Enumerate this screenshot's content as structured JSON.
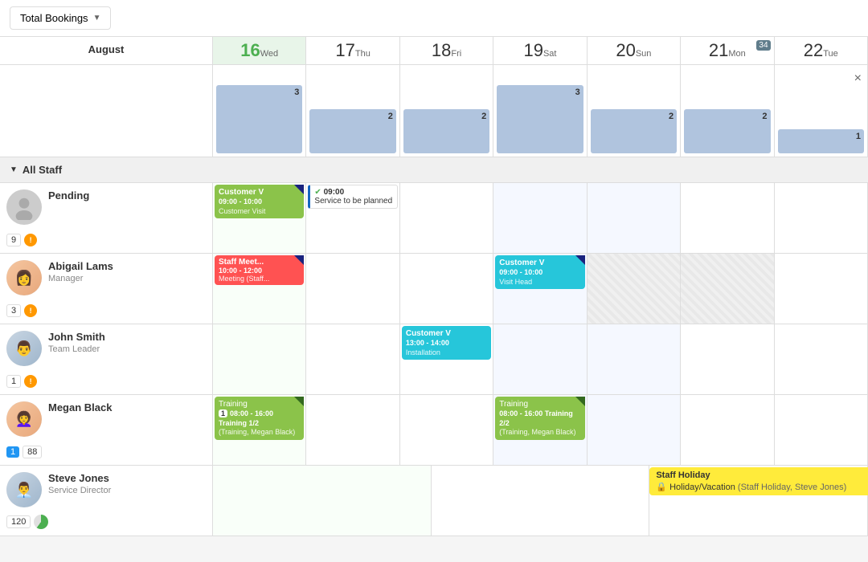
{
  "header": {
    "month": "August",
    "dropdown_label": "Total Bookings",
    "close_icon": "×"
  },
  "days": [
    {
      "number": "16",
      "name": "Wed",
      "today": true,
      "weekend": false
    },
    {
      "number": "17",
      "name": "Thu",
      "today": false,
      "weekend": false
    },
    {
      "number": "18",
      "name": "Fri",
      "today": false,
      "weekend": false
    },
    {
      "number": "19",
      "name": "Sat",
      "today": false,
      "weekend": true
    },
    {
      "number": "20",
      "name": "Sun",
      "today": false,
      "weekend": true
    },
    {
      "number": "21",
      "name": "Mon",
      "today": false,
      "weekend": false,
      "week_badge": "34"
    },
    {
      "number": "22",
      "name": "Tue",
      "today": false,
      "weekend": false
    }
  ],
  "booking_bars": [
    {
      "count": 3,
      "height": 85
    },
    {
      "count": 2,
      "height": 55
    },
    {
      "count": 2,
      "height": 55
    },
    {
      "count": 3,
      "height": 85
    },
    {
      "count": 2,
      "height": 55
    },
    {
      "count": 2,
      "height": 55
    },
    {
      "count": 1,
      "height": 30
    }
  ],
  "all_staff_label": "All Staff",
  "staff_rows": [
    {
      "name": "Pending",
      "role": "",
      "avatar_type": "silhouette",
      "badge_num": "9",
      "badge_warn": "!",
      "events": [
        {
          "col": 0,
          "type": "green-corner",
          "title": "Customer V",
          "time": "09:00 - 10:00",
          "sub": "Customer Visit"
        },
        {
          "col": 1,
          "type": "service",
          "check": true,
          "time": "09:00",
          "title": "Service to be planned"
        }
      ]
    },
    {
      "name": "Abigail Lams",
      "role": "Manager",
      "avatar_type": "photo_female1",
      "badge_num": "3",
      "badge_warn": "!",
      "events": [
        {
          "col": 0,
          "type": "red-staff",
          "title": "Staff Meet...",
          "time": "10:00 - 12:00",
          "sub": "Meeting  (Staff..."
        },
        {
          "col": 3,
          "type": "teal-corner",
          "title": "Customer V",
          "time": "09:00 - 10:00",
          "sub": "Visit Head"
        }
      ]
    },
    {
      "name": "John Smith",
      "role": "Team Leader",
      "avatar_type": "photo_male1",
      "badge_num": "1",
      "badge_warn": "!",
      "events": [
        {
          "col": 2,
          "type": "teal",
          "title": "Customer V",
          "time": "13:00 - 14:00",
          "sub": "Installation"
        }
      ]
    },
    {
      "name": "Megan Black",
      "role": "",
      "avatar_type": "photo_female2",
      "badge_blue": "1",
      "badge_88": "88",
      "events": [
        {
          "col": 0,
          "type": "training-green",
          "num": "1",
          "title": "Training 1/2",
          "time": "08:00 - 16:00",
          "sub": "(Training, Megan Black)"
        },
        {
          "col": 3,
          "type": "training-green",
          "title": "Training 2/2",
          "time": "08:00 - 16:00",
          "sub": "(Training, Megan Black)"
        }
      ]
    },
    {
      "name": "Steve Jones",
      "role": "Service Director",
      "avatar_type": "photo_male2",
      "badge_num": "120",
      "badge_pie": true,
      "events": [
        {
          "col": 2,
          "type": "holiday",
          "title": "Staff Holiday",
          "sub": "Holiday/Vacation  (Staff Holiday, Steve Jones)"
        }
      ]
    }
  ]
}
